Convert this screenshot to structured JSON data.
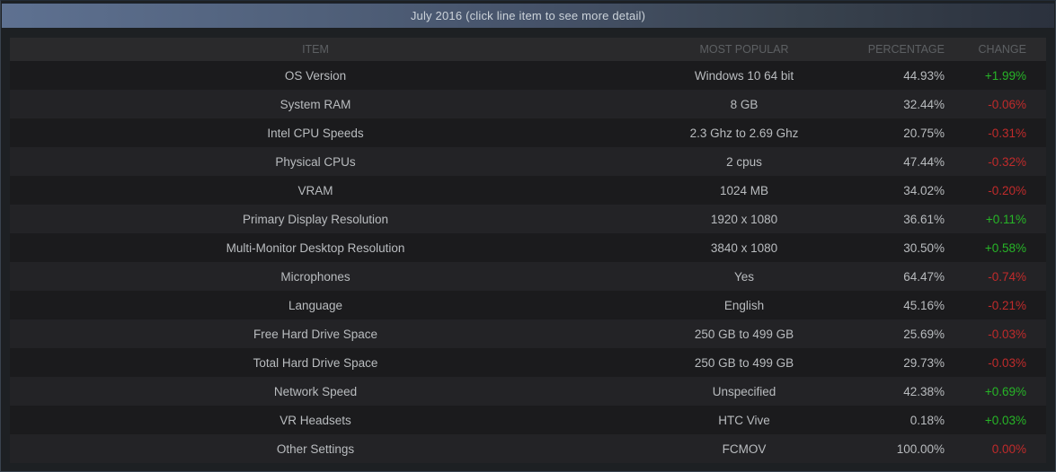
{
  "header": {
    "title": "July 2016 (click line item to see more detail)"
  },
  "table": {
    "columns": [
      "ITEM",
      "MOST POPULAR",
      "PERCENTAGE",
      "CHANGE"
    ],
    "rows": [
      {
        "item": "OS Version",
        "popular": "Windows 10 64 bit",
        "percentage": "44.93%",
        "change": "+1.99%",
        "direction": "up"
      },
      {
        "item": "System RAM",
        "popular": "8 GB",
        "percentage": "32.44%",
        "change": "-0.06%",
        "direction": "down"
      },
      {
        "item": "Intel CPU Speeds",
        "popular": "2.3 Ghz to 2.69 Ghz",
        "percentage": "20.75%",
        "change": "-0.31%",
        "direction": "down"
      },
      {
        "item": "Physical CPUs",
        "popular": "2 cpus",
        "percentage": "47.44%",
        "change": "-0.32%",
        "direction": "down"
      },
      {
        "item": "VRAM",
        "popular": "1024 MB",
        "percentage": "34.02%",
        "change": "-0.20%",
        "direction": "down"
      },
      {
        "item": "Primary Display Resolution",
        "popular": "1920 x 1080",
        "percentage": "36.61%",
        "change": "+0.11%",
        "direction": "up"
      },
      {
        "item": "Multi-Monitor Desktop Resolution",
        "popular": "3840 x 1080",
        "percentage": "30.50%",
        "change": "+0.58%",
        "direction": "up"
      },
      {
        "item": "Microphones",
        "popular": "Yes",
        "percentage": "64.47%",
        "change": "-0.74%",
        "direction": "down"
      },
      {
        "item": "Language",
        "popular": "English",
        "percentage": "45.16%",
        "change": "-0.21%",
        "direction": "down"
      },
      {
        "item": "Free Hard Drive Space",
        "popular": "250 GB to 499 GB",
        "percentage": "25.69%",
        "change": "-0.03%",
        "direction": "down"
      },
      {
        "item": "Total Hard Drive Space",
        "popular": "250 GB to 499 GB",
        "percentage": "29.73%",
        "change": "-0.03%",
        "direction": "down"
      },
      {
        "item": "Network Speed",
        "popular": "Unspecified",
        "percentage": "42.38%",
        "change": "+0.69%",
        "direction": "up"
      },
      {
        "item": "VR Headsets",
        "popular": "HTC Vive",
        "percentage": "0.18%",
        "change": "+0.03%",
        "direction": "up"
      },
      {
        "item": "Other Settings",
        "popular": "FCMOV",
        "percentage": "100.00%",
        "change": "0.00%",
        "direction": "down"
      }
    ]
  },
  "colors": {
    "positive": "#27b527",
    "negative": "#c02b2b"
  }
}
